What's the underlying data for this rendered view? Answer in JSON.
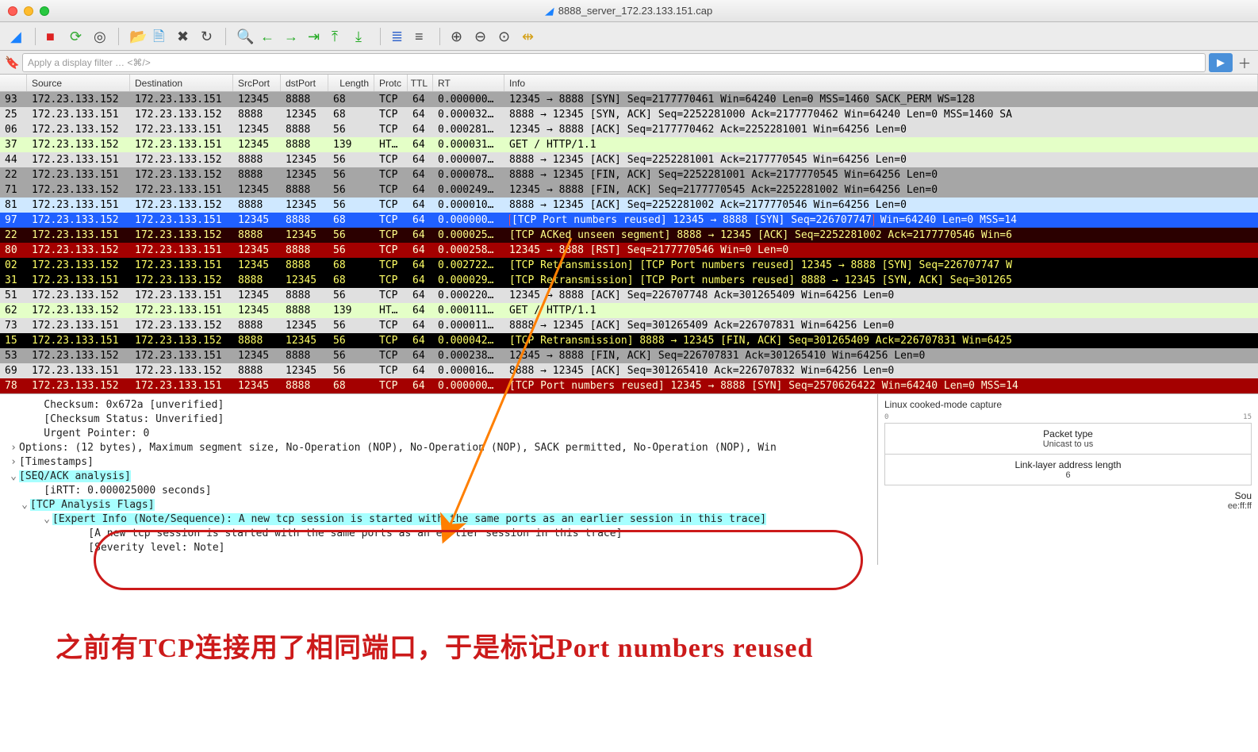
{
  "window_title": "8888_server_172.23.133.151.cap",
  "filter_placeholder": "Apply a display filter … <⌘/>",
  "columns": [
    "",
    "Source",
    "Destination",
    "SrcPort",
    "dstPort",
    "Length",
    "Protc",
    "TTL",
    "RT",
    "Info"
  ],
  "rows": [
    {
      "no": "93",
      "src": "172.23.133.152",
      "dst": "172.23.133.151",
      "sp": "12345",
      "dp": "8888",
      "len": "68",
      "pro": "TCP",
      "ttl": "64",
      "rt": "0.000000…",
      "info": "12345 → 8888 [SYN] Seq=2177770461 Win=64240 Len=0 MSS=1460 SACK_PERM WS=128",
      "theme": "gray"
    },
    {
      "no": "25",
      "src": "172.23.133.151",
      "dst": "172.23.133.152",
      "sp": "8888",
      "dp": "12345",
      "len": "68",
      "pro": "TCP",
      "ttl": "64",
      "rt": "0.000032…",
      "info": "8888 → 12345 [SYN, ACK] Seq=2252281000 Ack=2177770462 Win=64240 Len=0 MSS=1460 SA",
      "theme": "softgray"
    },
    {
      "no": "06",
      "src": "172.23.133.152",
      "dst": "172.23.133.151",
      "sp": "12345",
      "dp": "8888",
      "len": "56",
      "pro": "TCP",
      "ttl": "64",
      "rt": "0.000281…",
      "info": "12345 → 8888 [ACK] Seq=2177770462 Ack=2252281001 Win=64256 Len=0",
      "theme": "softgray"
    },
    {
      "no": "37",
      "src": "172.23.133.152",
      "dst": "172.23.133.151",
      "sp": "12345",
      "dp": "8888",
      "len": "139",
      "pro": "HT…",
      "ttl": "64",
      "rt": "0.000031…",
      "info": "GET / HTTP/1.1",
      "theme": "green"
    },
    {
      "no": "44",
      "src": "172.23.133.151",
      "dst": "172.23.133.152",
      "sp": "8888",
      "dp": "12345",
      "len": "56",
      "pro": "TCP",
      "ttl": "64",
      "rt": "0.000007…",
      "info": "8888 → 12345 [ACK] Seq=2252281001 Ack=2177770545 Win=64256 Len=0",
      "theme": "softgray"
    },
    {
      "no": "22",
      "src": "172.23.133.151",
      "dst": "172.23.133.152",
      "sp": "8888",
      "dp": "12345",
      "len": "56",
      "pro": "TCP",
      "ttl": "64",
      "rt": "0.000078…",
      "info": "8888 → 12345 [FIN, ACK] Seq=2252281001 Ack=2177770545 Win=64256 Len=0",
      "theme": "gray"
    },
    {
      "no": "71",
      "src": "172.23.133.152",
      "dst": "172.23.133.151",
      "sp": "12345",
      "dp": "8888",
      "len": "56",
      "pro": "TCP",
      "ttl": "64",
      "rt": "0.000249…",
      "info": "12345 → 8888 [FIN, ACK] Seq=2177770545 Ack=2252281002 Win=64256 Len=0",
      "theme": "gray"
    },
    {
      "no": "81",
      "src": "172.23.133.151",
      "dst": "172.23.133.152",
      "sp": "8888",
      "dp": "12345",
      "len": "56",
      "pro": "TCP",
      "ttl": "64",
      "rt": "0.000010…",
      "info": "8888 → 12345 [ACK] Seq=2252281002 Ack=2177770546 Win=64256 Len=0",
      "theme": "lblue"
    },
    {
      "no": "97",
      "src": "172.23.133.152",
      "dst": "172.23.133.151",
      "sp": "12345",
      "dp": "8888",
      "len": "68",
      "pro": "TCP",
      "ttl": "64",
      "rt": "0.000000…",
      "info": "[TCP Port numbers reused] 12345 → 8888 [SYN] Seq=226707747",
      "info2": " Win=64240 Len=0 MSS=14",
      "theme": "sel",
      "boxed": true
    },
    {
      "no": "22",
      "src": "172.23.133.151",
      "dst": "172.23.133.152",
      "sp": "8888",
      "dp": "12345",
      "len": "56",
      "pro": "TCP",
      "ttl": "64",
      "rt": "0.000025…",
      "info": "[TCP ACKed unseen segment] 8888 → 12345 [ACK] Seq=2252281002 Ack=2177770546 Win=6",
      "theme": "ack-bad"
    },
    {
      "no": "80",
      "src": "172.23.133.152",
      "dst": "172.23.133.151",
      "sp": "12345",
      "dp": "8888",
      "len": "56",
      "pro": "TCP",
      "ttl": "64",
      "rt": "0.000258…",
      "info": "12345 → 8888 [RST] Seq=2177770546 Win=0 Len=0",
      "theme": "baddark"
    },
    {
      "no": "02",
      "src": "172.23.133.152",
      "dst": "172.23.133.151",
      "sp": "12345",
      "dp": "8888",
      "len": "68",
      "pro": "TCP",
      "ttl": "64",
      "rt": "0.002722…",
      "info": "[TCP Retransmission] [TCP Port numbers reused] 12345 → 8888 [SYN] Seq=226707747 W",
      "theme": "black"
    },
    {
      "no": "31",
      "src": "172.23.133.151",
      "dst": "172.23.133.152",
      "sp": "8888",
      "dp": "12345",
      "len": "68",
      "pro": "TCP",
      "ttl": "64",
      "rt": "0.000029…",
      "info": "[TCP Retransmission] [TCP Port numbers reused] 8888 → 12345 [SYN, ACK] Seq=301265",
      "theme": "black"
    },
    {
      "no": "51",
      "src": "172.23.133.152",
      "dst": "172.23.133.151",
      "sp": "12345",
      "dp": "8888",
      "len": "56",
      "pro": "TCP",
      "ttl": "64",
      "rt": "0.000220…",
      "info": "12345 → 8888 [ACK] Seq=226707748 Ack=301265409 Win=64256 Len=0",
      "theme": "softgray"
    },
    {
      "no": "62",
      "src": "172.23.133.152",
      "dst": "172.23.133.151",
      "sp": "12345",
      "dp": "8888",
      "len": "139",
      "pro": "HT…",
      "ttl": "64",
      "rt": "0.000111…",
      "info": "GET / HTTP/1.1",
      "theme": "green"
    },
    {
      "no": "73",
      "src": "172.23.133.151",
      "dst": "172.23.133.152",
      "sp": "8888",
      "dp": "12345",
      "len": "56",
      "pro": "TCP",
      "ttl": "64",
      "rt": "0.000011…",
      "info": "8888 → 12345 [ACK] Seq=301265409 Ack=226707831 Win=64256 Len=0",
      "theme": "softgray"
    },
    {
      "no": "15",
      "src": "172.23.133.151",
      "dst": "172.23.133.152",
      "sp": "8888",
      "dp": "12345",
      "len": "56",
      "pro": "TCP",
      "ttl": "64",
      "rt": "0.000042…",
      "info": "[TCP Retransmission] 8888 → 12345 [FIN, ACK] Seq=301265409 Ack=226707831 Win=6425",
      "theme": "black"
    },
    {
      "no": "53",
      "src": "172.23.133.152",
      "dst": "172.23.133.151",
      "sp": "12345",
      "dp": "8888",
      "len": "56",
      "pro": "TCP",
      "ttl": "64",
      "rt": "0.000238…",
      "info": "12345 → 8888 [FIN, ACK] Seq=226707831 Ack=301265410 Win=64256 Len=0",
      "theme": "gray"
    },
    {
      "no": "69",
      "src": "172.23.133.151",
      "dst": "172.23.133.152",
      "sp": "8888",
      "dp": "12345",
      "len": "56",
      "pro": "TCP",
      "ttl": "64",
      "rt": "0.000016…",
      "info": "8888 → 12345 [ACK] Seq=301265410 Ack=226707832 Win=64256 Len=0",
      "theme": "softgray"
    },
    {
      "no": "78",
      "src": "172.23.133.152",
      "dst": "172.23.133.151",
      "sp": "12345",
      "dp": "8888",
      "len": "68",
      "pro": "TCP",
      "ttl": "64",
      "rt": "0.000000…",
      "info": "[TCP Port numbers reused] 12345 → 8888 [SYN] Seq=2570626422 Win=64240 Len=0 MSS=14",
      "theme": "baddark"
    }
  ],
  "tree": {
    "checksum": "    Checksum: 0x672a [unverified]",
    "checksum_status": "    [Checksum Status: Unverified]",
    "urgent": "    Urgent Pointer: 0",
    "options": "Options: (12 bytes), Maximum segment size, No-Operation (NOP), No-Operation (NOP), SACK permitted, No-Operation (NOP), Win",
    "timestamps": "[Timestamps]",
    "seqack": "[SEQ/ACK analysis]",
    "irtt": "    [iRTT: 0.000025000 seconds]",
    "flags": "[TCP Analysis Flags]",
    "expert": "[Expert Info (Note/Sequence): A new tcp session is started with the same ports as an earlier session in this trace]",
    "expert_msg": "    [A new tcp session is started with the same ports as an earlier session in this trace]",
    "severity": "    [Severity level: Note]"
  },
  "bytes": {
    "title": "Linux cooked-mode capture",
    "ruler_start": "0",
    "ruler_end": "15",
    "packet_type_lbl": "Packet type",
    "packet_type_val": "Unicast to us",
    "lladdr_lbl": "Link-layer address length",
    "lladdr_val": "6",
    "src_lbl": "Sou",
    "src_val": "ee:ff:ff"
  },
  "handnote": "之前有TCP连接用了相同端口，于是标记Port numbers reused"
}
